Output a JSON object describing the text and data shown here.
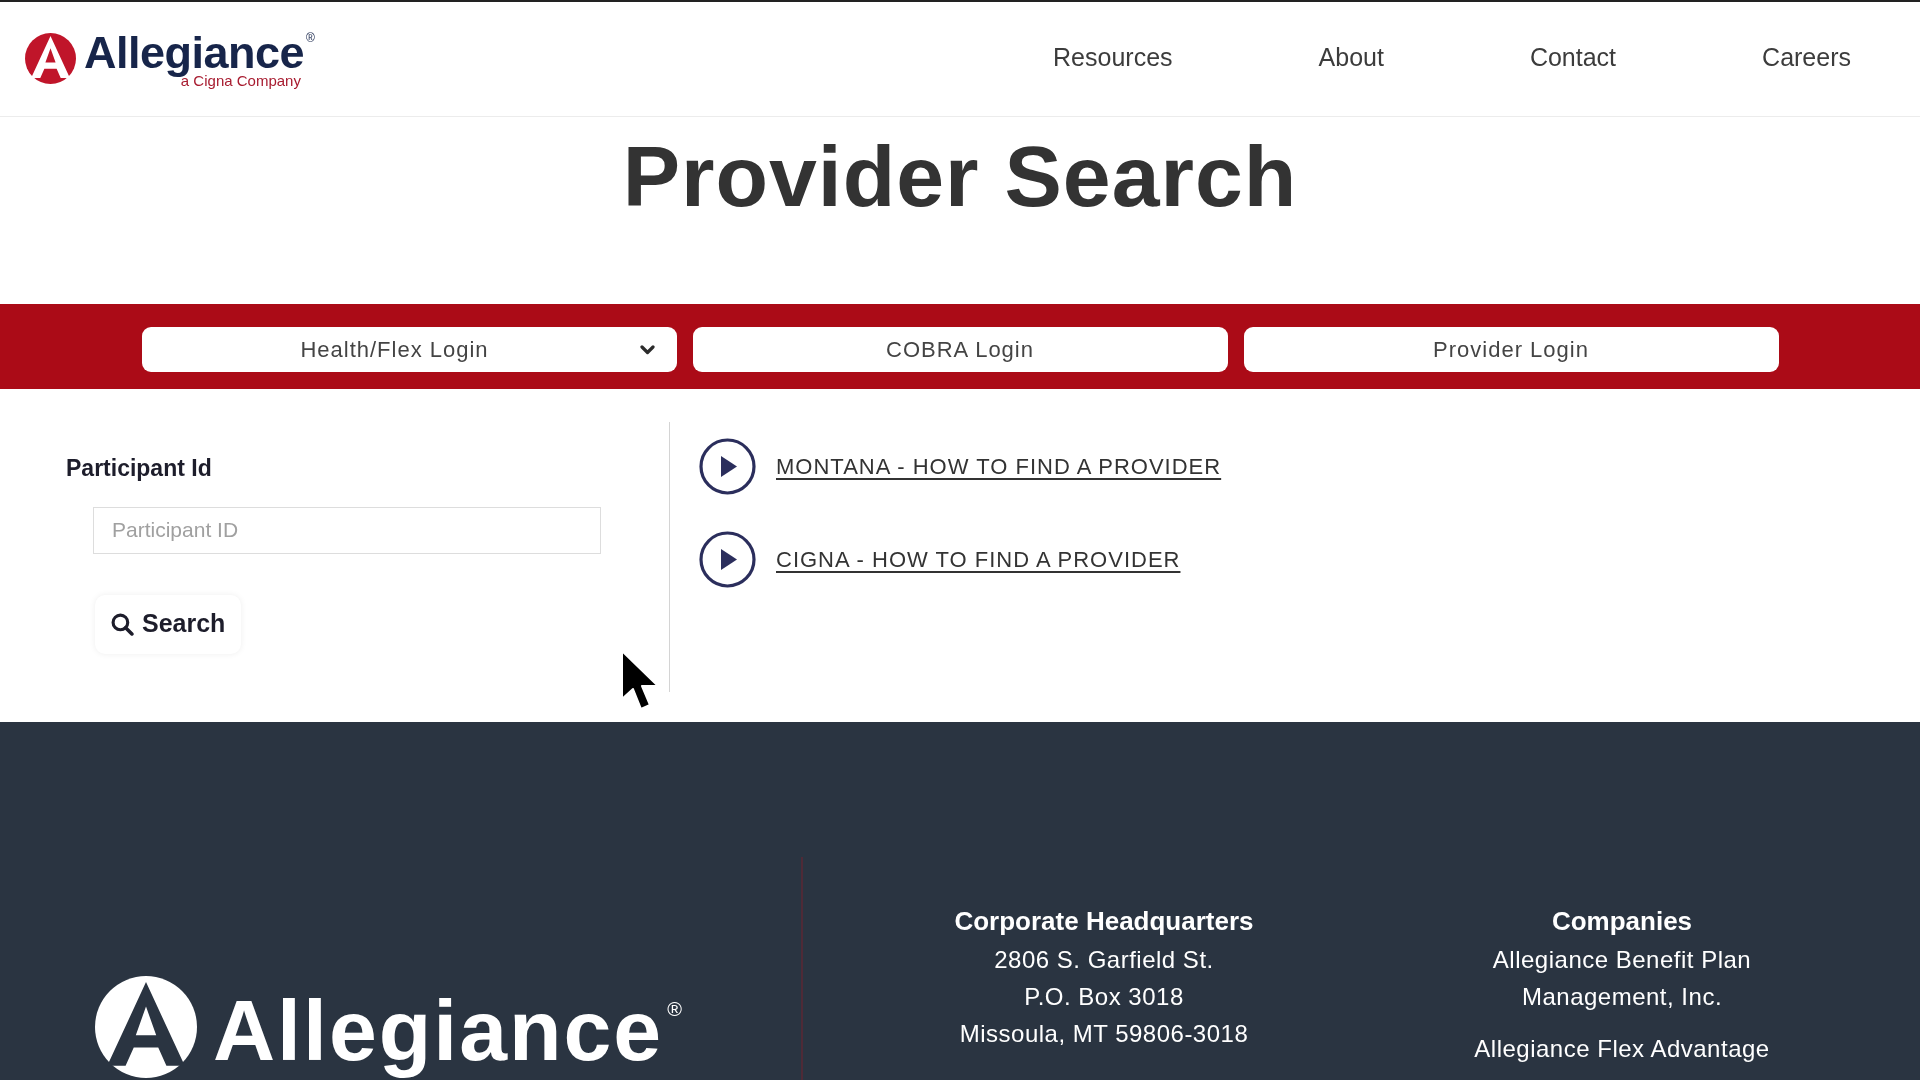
{
  "header": {
    "logo": {
      "name": "Allegiance",
      "registered": "®",
      "tagline": "a Cigna Company"
    },
    "nav": [
      "Resources",
      "About",
      "Contact",
      "Careers"
    ]
  },
  "page_title": "Provider Search",
  "login_bar": [
    {
      "label": "Health/Flex Login",
      "kind": "dropdown"
    },
    {
      "label": "COBRA Login",
      "kind": "button"
    },
    {
      "label": "Provider Login",
      "kind": "button"
    }
  ],
  "search_panel": {
    "label": "Participant Id",
    "field": {
      "placeholder": "Participant ID"
    },
    "button": "Search"
  },
  "video_links": [
    "MONTANA - HOW TO FIND A PROVIDER",
    "CIGNA - HOW TO FIND A PROVIDER"
  ],
  "footer": {
    "logo": {
      "name": "Allegiance",
      "registered": "®"
    },
    "columns": [
      {
        "title": "Corporate Headquarters",
        "lines": [
          "2806 S. Garfield St.",
          "P.O. Box 3018",
          "Missoula, MT 59806-3018"
        ]
      },
      {
        "title": "Companies",
        "lines": [
          "Allegiance Benefit Plan Management, Inc.",
          "Allegiance Flex Advantage"
        ]
      }
    ]
  }
}
